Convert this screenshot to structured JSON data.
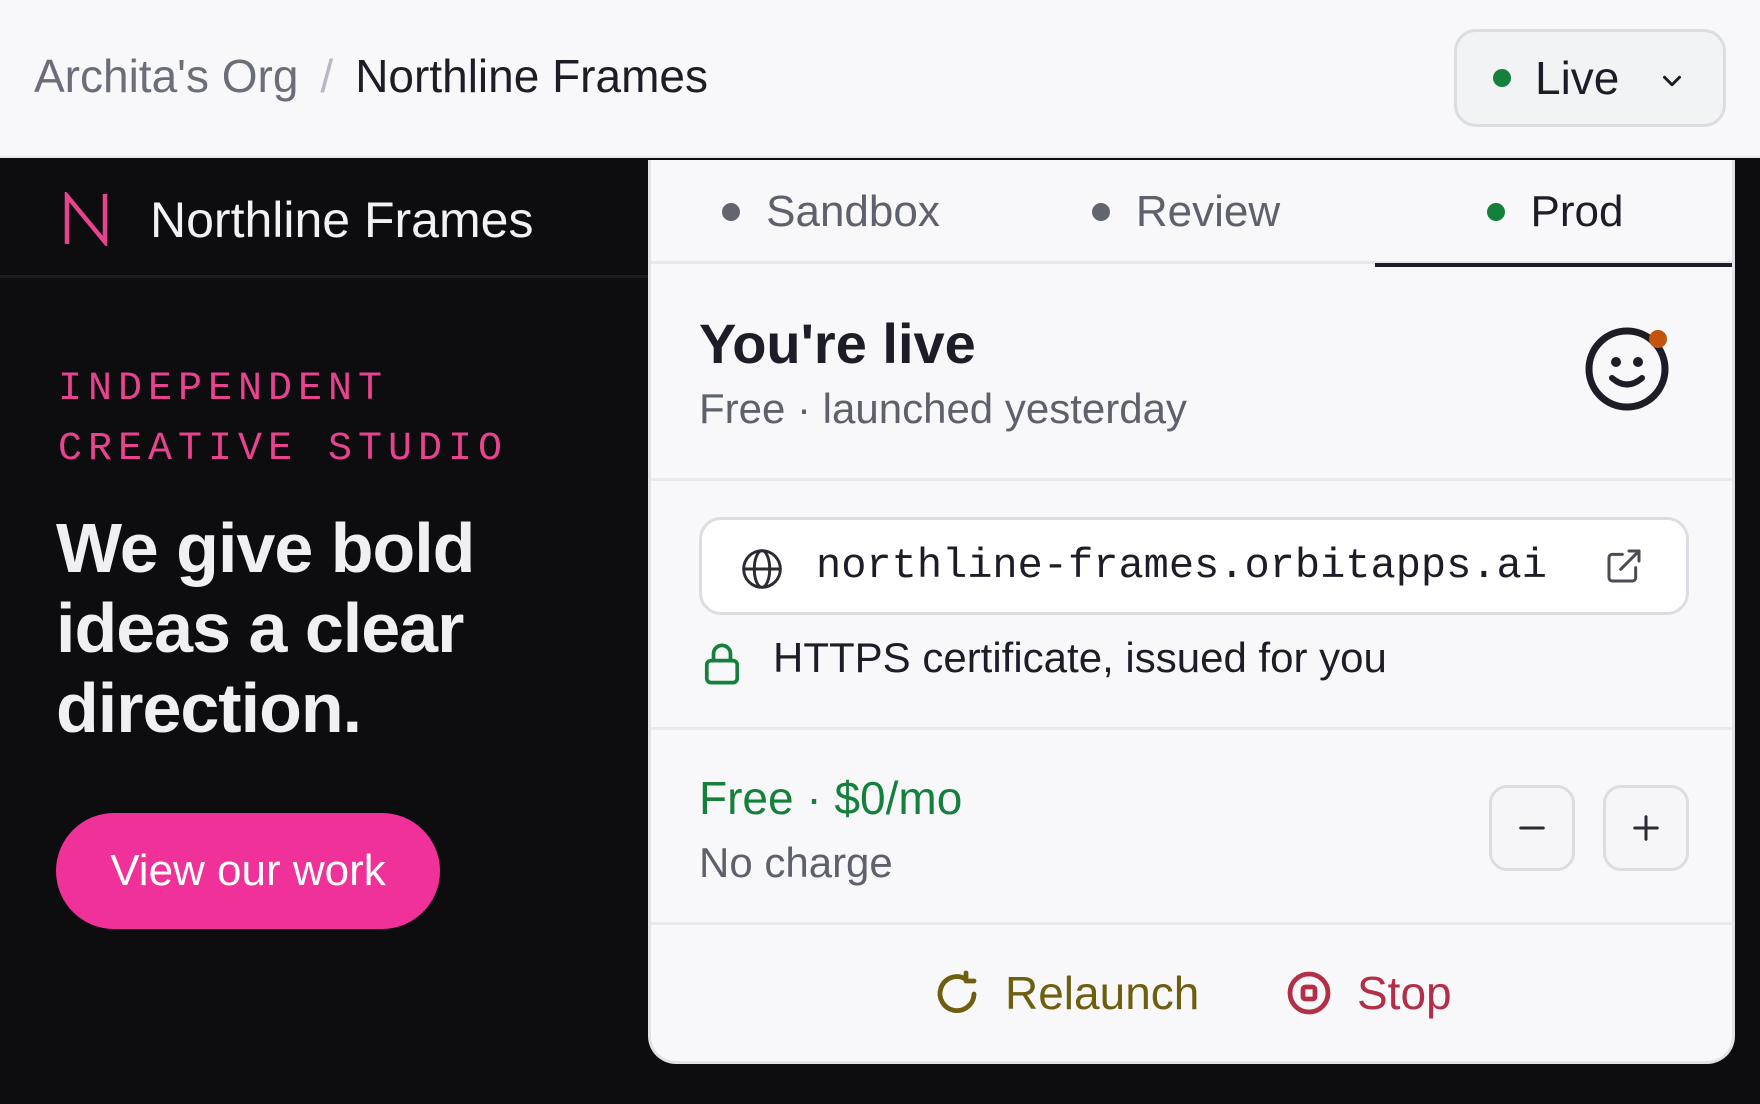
{
  "breadcrumb": {
    "org": "Archita's Org",
    "separator": "/",
    "project": "Northline Frames"
  },
  "status_button": {
    "label": "Live",
    "color": "#14803c"
  },
  "preview": {
    "brand": "Northline Frames",
    "logo_letter": "N",
    "eyebrow": "INDEPENDENT CREATIVE STUDIO",
    "headline": "We give bold ideas a clear direction.",
    "cta": "View our work",
    "accent": "#f0319a"
  },
  "tabs": [
    {
      "label": "Sandbox",
      "active": false
    },
    {
      "label": "Review",
      "active": false
    },
    {
      "label": "Prod",
      "active": true
    }
  ],
  "status": {
    "title": "You're live",
    "subtitle": "Free · launched yesterday"
  },
  "domain": {
    "url": "northline-frames.orbitapps.ai",
    "https": "HTTPS certificate, issued for you"
  },
  "plan": {
    "title": "Free · $0/mo",
    "subtitle": "No charge"
  },
  "actions": {
    "relaunch": "Relaunch",
    "stop": "Stop"
  }
}
